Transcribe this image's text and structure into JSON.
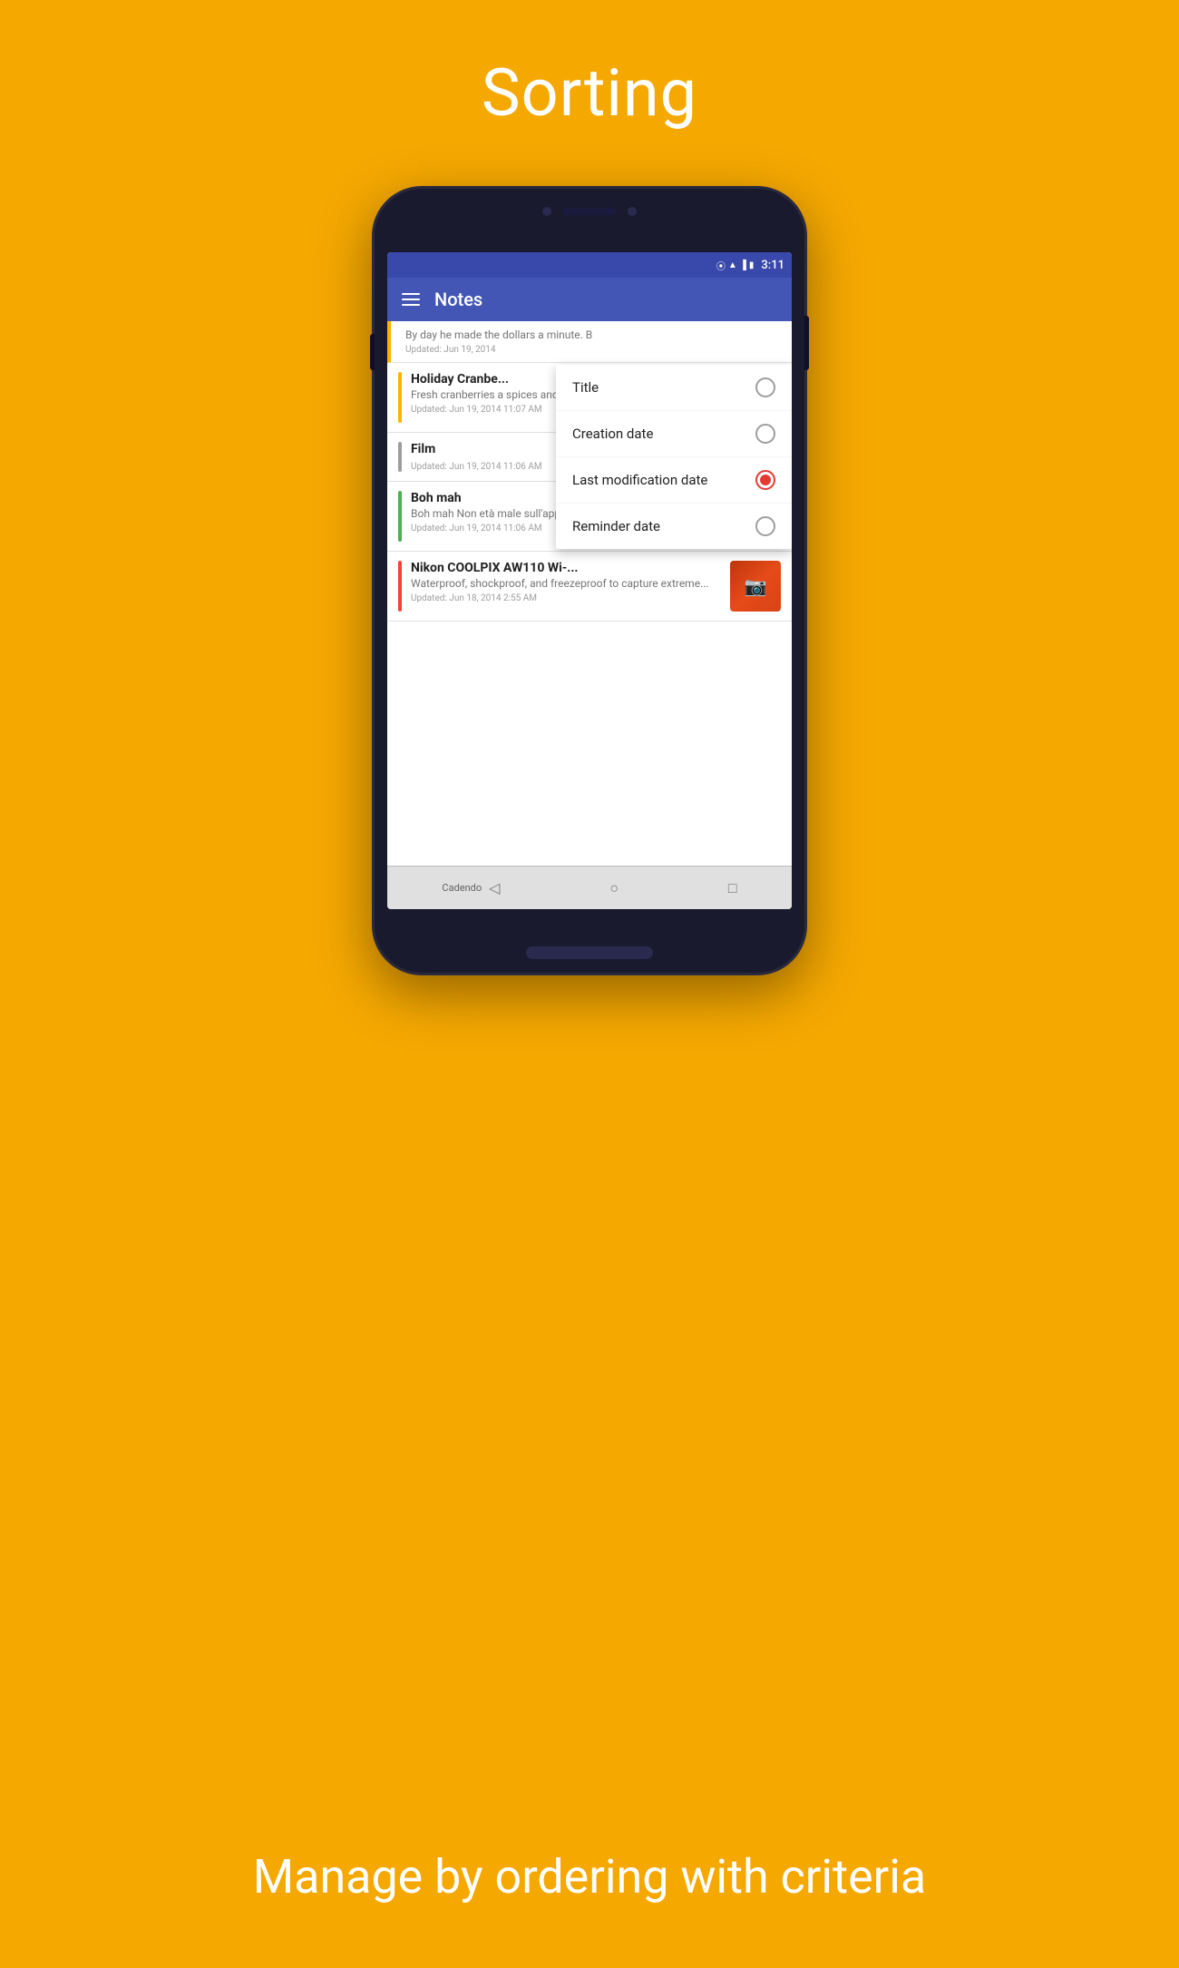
{
  "page": {
    "title": "Sorting",
    "subtitle": "Manage by ordering with criteria",
    "background_color": "#F5A800"
  },
  "status_bar": {
    "time": "3:11",
    "icons": [
      "location",
      "wifi",
      "signal",
      "battery"
    ]
  },
  "app_header": {
    "title": "Notes",
    "menu_icon": "hamburger"
  },
  "sort_popup": {
    "options": [
      {
        "label": "Title",
        "selected": false
      },
      {
        "label": "Creation date",
        "selected": false
      },
      {
        "label": "Last modification date",
        "selected": true
      },
      {
        "label": "Reminder date",
        "selected": false
      }
    ]
  },
  "notes": [
    {
      "id": "note-1",
      "color": "#FFB300",
      "title": "",
      "preview": "By day he made the dollars a minute. B",
      "date": "Updated: Jun 19, 2014",
      "has_image": false,
      "partial": true
    },
    {
      "id": "note-2",
      "color": "#FFB300",
      "title": "Holiday Cranbe...",
      "preview": "Fresh cranberries a spices and cooked with sugar to...",
      "date": "Updated: Jun 19, 2014 11:07 AM",
      "has_image": true,
      "image_type": "cranberry"
    },
    {
      "id": "note-3",
      "color": "#9E9E9E",
      "title": "Film",
      "preview": "",
      "date": "Updated: Jun 19, 2014 11:06 AM",
      "has_image": false
    },
    {
      "id": "note-4",
      "color": "#4CAF50",
      "title": "Boh mah",
      "preview": "Boh mah\nNon età male sull'applicazione...",
      "date": "Updated: Jun 19, 2014 11:06 AM",
      "has_image": true,
      "image_type": "concert"
    },
    {
      "id": "note-5",
      "color": "#F44336",
      "title": "Nikon COOLPIX AW110 Wi-...",
      "preview": "Waterproof, shockproof, and freezeproof to capture extreme...",
      "date": "Updated: Jun 18, 2014 2:55 AM",
      "has_image": true,
      "image_type": "camera"
    }
  ],
  "bottom_nav": {
    "back_label": "◁",
    "home_label": "○",
    "recents_label": "□",
    "app_label": "Cadendo"
  }
}
